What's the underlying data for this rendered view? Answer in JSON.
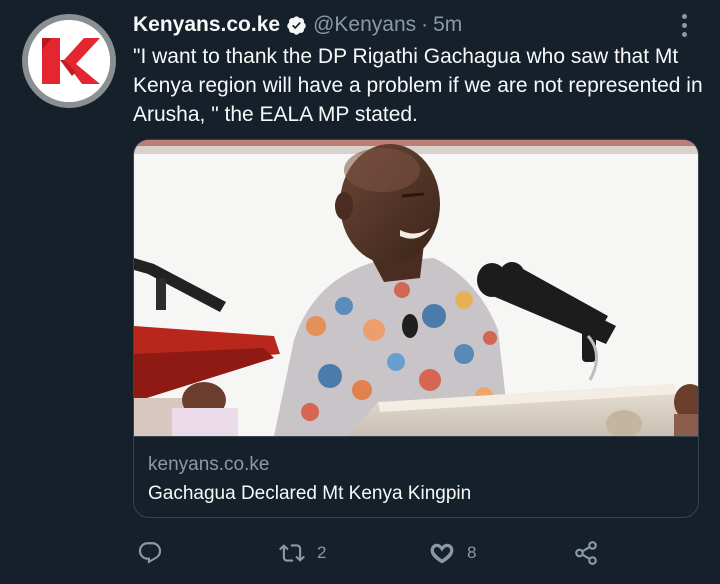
{
  "author": {
    "display_name": "Kenyans.co.ke",
    "handle": "@Kenyans",
    "separator": "·",
    "time": "5m",
    "verified": true
  },
  "tweet": {
    "text": "\"I want to thank the DP Rigathi Gachagua who saw that Mt Kenya region will have a problem if we are not represented in Arusha, \" the EALA MP stated."
  },
  "card": {
    "domain": "kenyans.co.ke",
    "title": "Gachagua Declared Mt Kenya Kingpin"
  },
  "actions": {
    "reply_count": "",
    "retweet_count": "2",
    "like_count": "8"
  },
  "colors": {
    "background": "#15202b",
    "text": "#f7f9f9",
    "secondary": "#8b98a5",
    "verified": "#f7f9f9",
    "brand_red": "#e3262f"
  },
  "icons": [
    "verified-badge-icon",
    "more-icon",
    "reply-icon",
    "retweet-icon",
    "like-icon",
    "share-icon"
  ]
}
